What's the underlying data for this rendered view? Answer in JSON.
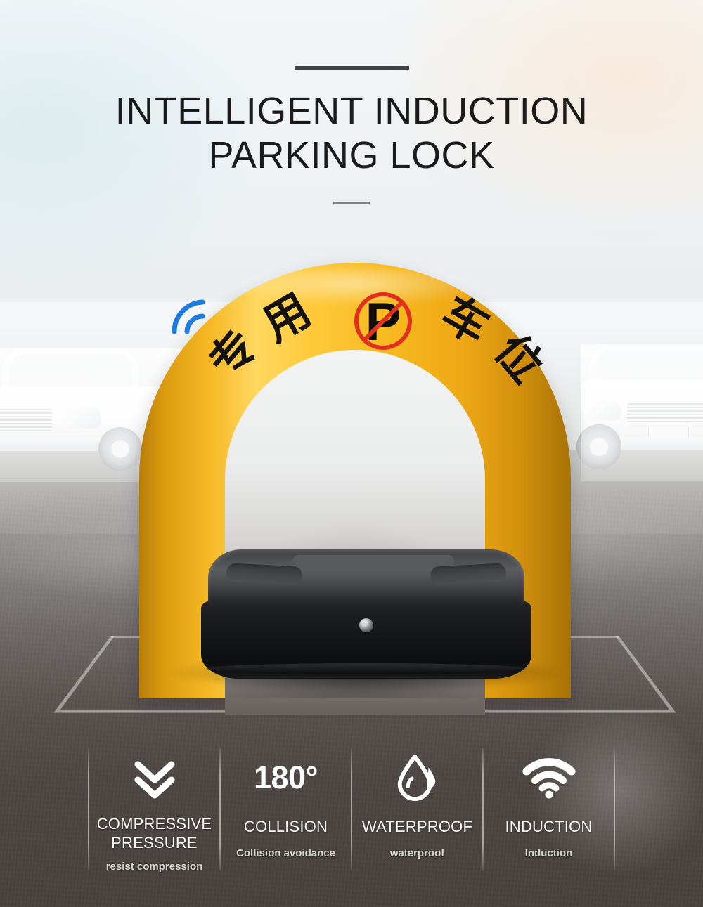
{
  "header": {
    "rule_top": "",
    "title_line_1": "INTELLIGENT INDUCTION",
    "title_line_2": "PARKING LOCK",
    "rule_bottom": ""
  },
  "product": {
    "arch_text_left": "专用",
    "arch_text_right": "车位",
    "arch_char_1": "专",
    "arch_char_2": "用",
    "arch_char_3": "车",
    "arch_char_4": "位",
    "sign_letter": "P",
    "sign_name": "no-parking-sign",
    "signal_name": "wireless-signal-indicator",
    "colors": {
      "arch_yellow": "#F7B91F",
      "arch_yellow_highlight": "#FFD860",
      "arch_yellow_shadow": "#B87D08",
      "base_black": "#131415",
      "sign_red": "#E1301E",
      "signal_blue": "#1E7BE0"
    }
  },
  "scene": {
    "ground_outline_name": "parking-space-outline",
    "background_cars": [
      {
        "name": "car-left-white-sedan"
      },
      {
        "name": "car-center-white-sedan"
      },
      {
        "name": "car-right-white-suv"
      }
    ]
  },
  "features": [
    {
      "icon": "double-chevron-down-icon",
      "icon_text": "",
      "title": "COMPRESSIVE PRESSURE",
      "subtitle": "resist compression"
    },
    {
      "icon": "degree-180-text",
      "icon_text": "180°",
      "title": "COLLISION",
      "subtitle": "Collision avoidance"
    },
    {
      "icon": "water-drop-icon",
      "icon_text": "",
      "title": "WATERPROOF",
      "subtitle": "waterproof"
    },
    {
      "icon": "wifi-icon",
      "icon_text": "",
      "title": "INDUCTION",
      "subtitle": "Induction"
    }
  ]
}
